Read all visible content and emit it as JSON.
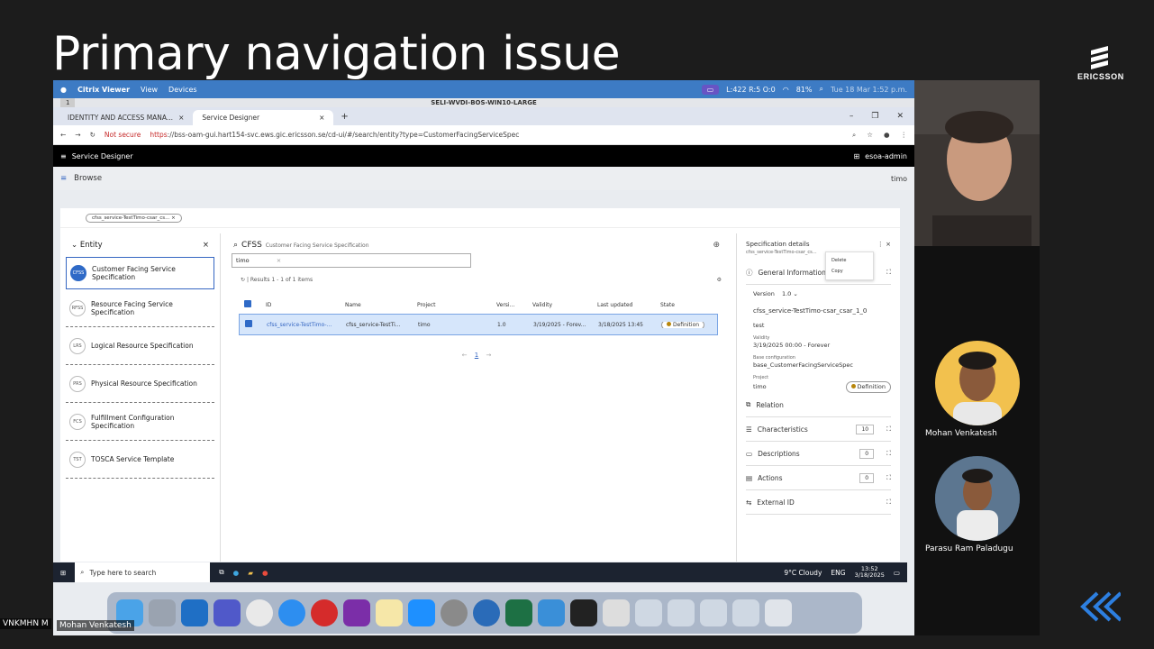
{
  "slide": {
    "title": "Primary navigation issue",
    "logo_text": "ERICSSON"
  },
  "mac_bar": {
    "items": [
      "Citrix Viewer",
      "View",
      "Devices"
    ],
    "status": "L:422 R:5 O:0",
    "battery": "81%",
    "datetime": "Tue 18 Mar 1:52 p.m."
  },
  "vdi": {
    "name": "SELI-WVDI-BOS-WIN10-LARGE",
    "left_tag": "1"
  },
  "browser": {
    "tabs": [
      "IDENTITY AND ACCESS MANA...",
      "Service Designer"
    ],
    "security": "Not secure",
    "url_red": "https",
    "url_rest": "://bss-oam-gui.hart154-svc.ews.gic.ericsson.se/cd-ui/#/search/entity?type=CustomerFacingServiceSpec"
  },
  "app": {
    "name": "Service Designer",
    "user": "esoa-admin",
    "breadcrumb": "Browse",
    "browse_user": "timo",
    "chip": "cfss_service-TestTimo-csar_cs..."
  },
  "entity": {
    "title": "Entity",
    "items": [
      {
        "abbr": "CFSS",
        "label": "Customer Facing Service Specification"
      },
      {
        "abbr": "RFSS",
        "label": "Resource Facing Service Specification"
      },
      {
        "abbr": "LRS",
        "label": "Logical Resource Specification"
      },
      {
        "abbr": "PRS",
        "label": "Physical Resource Specification"
      },
      {
        "abbr": "FCS",
        "label": "Fulfillment Configuration Specification"
      },
      {
        "abbr": "TST",
        "label": "TOSCA Service Template"
      }
    ]
  },
  "search": {
    "type_abbr": "CFSS",
    "type_name": "Customer Facing Service Specification",
    "query": "timo",
    "results": "Results 1 - 1 of 1 items",
    "columns": [
      "ID",
      "Name",
      "Project",
      "Versi...",
      "Validity",
      "Last updated",
      "State"
    ],
    "row": {
      "id": "cfss_service-TestTimo-...",
      "name": "cfss_service-TestTi...",
      "project": "timo",
      "version": "1.0",
      "validity": "3/19/2025 - Forev...",
      "last_updated": "3/18/2025 13:45",
      "state": "Definition"
    },
    "page": "1"
  },
  "details": {
    "title": "Specification details",
    "subtitle": "cfss_service-TestTimo-csar_cs...",
    "menu": [
      "Delete",
      "Copy"
    ],
    "general": "General Information",
    "version_label": "Version",
    "version_value": "1.0",
    "spec_name": "cfss_service-TestTimo-csar_csar_1_0",
    "desc": "test",
    "validity_label": "Validity",
    "validity_value": "3/19/2025 00:00 - Forever",
    "base_label": "Base configuration",
    "base_value": "base_CustomerFacingServiceSpec",
    "project_label": "Project",
    "project_value": "timo",
    "state": "Definition",
    "sections": [
      {
        "label": "Relation",
        "count": ""
      },
      {
        "label": "Characteristics",
        "count": "10"
      },
      {
        "label": "Descriptions",
        "count": "0"
      },
      {
        "label": "Actions",
        "count": "0"
      },
      {
        "label": "External ID",
        "count": ""
      }
    ]
  },
  "taskbar": {
    "search_placeholder": "Type here to search",
    "weather": "9°C Cloudy",
    "lang": "ENG",
    "time": "13:52",
    "date": "3/18/2025"
  },
  "participants": [
    {
      "name": "Mohan Venkatesh"
    },
    {
      "name": "Parasu Ram Paladugu"
    }
  ],
  "bottom_labels": {
    "left_cut": "VNKMHN M",
    "share_owner": "Mohan Venkatesh"
  }
}
